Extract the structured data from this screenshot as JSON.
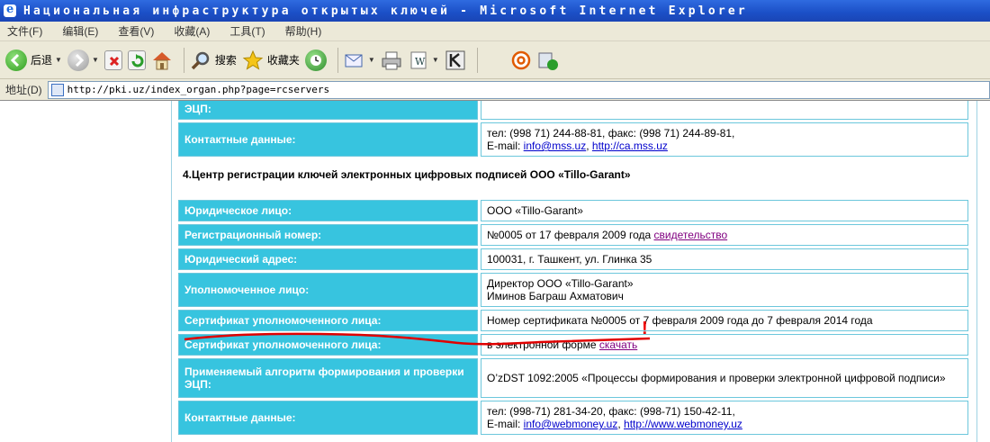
{
  "window": {
    "title": "Национальная инфраструктура открытых ключей - Microsoft Internet Explorer"
  },
  "menu": [
    "文件(F)",
    "编辑(E)",
    "查看(V)",
    "收藏(A)",
    "工具(T)",
    "帮助(H)"
  ],
  "toolbar": {
    "back": "后退",
    "search": "搜索",
    "favorites": "收藏夹"
  },
  "address": {
    "label": "地址(D)",
    "url": "http://pki.uz/index_organ.php?page=rcservers"
  },
  "prev_block": {
    "top_label": "ЭЦП:",
    "contacts_label": "Контактные данные:",
    "contacts_line1": "тел: (998 71) 244-88-81, факс: (998 71) 244-89-81,",
    "email_prefix": "E-mail: ",
    "email": "info@mss.uz",
    "comma": ", ",
    "site": "http://ca.mss.uz"
  },
  "section4": {
    "heading": "4.Центр регистрации ключей электронных цифровых подписей ООО «Tillo-Garant»",
    "rows": {
      "legal_label": "Юридическое лицо:",
      "legal_value": "ООО «Tillo-Garant»",
      "reg_label": "Регистрационный номер:",
      "reg_value": "№0005 от 17 февраля 2009 года ",
      "reg_link": "свидетельство",
      "addr_label": "Юридический адрес:",
      "addr_value": "100031, г. Ташкент, ул. Глинка 35",
      "person_label": "Уполномоченное лицо:",
      "person_line1": "Директор ООО «Tillo-Garant»",
      "person_line2": "Иминов Баграш Ахматович",
      "cert1_label": "Сертификат уполномоченного лица:",
      "cert1_value": "Номер сертификата №0005 от 7 февраля 2009 года до 7 февраля 2014 года",
      "cert2_label": "Сертификат уполномоченного лица:",
      "cert2_value": "в электронной форме ",
      "cert2_link": "скачать",
      "algo_label": "Применяемый алгоритм формирования и проверки ЭЦП:",
      "algo_value": "O’zDST 1092:2005 «Процессы формирования и проверки электронной цифровой подписи»",
      "contacts_label": "Контактные данные:",
      "contacts_line1": "тел: (998-71) 281-34-20, факс: (998-71) 150-42-11,",
      "email_prefix": "E-mail: ",
      "email": "info@webmoney.uz",
      "comma": ", ",
      "site": "http://www.webmoney.uz"
    }
  },
  "annotation": {
    "mark": "!",
    "color": "#e00000"
  }
}
